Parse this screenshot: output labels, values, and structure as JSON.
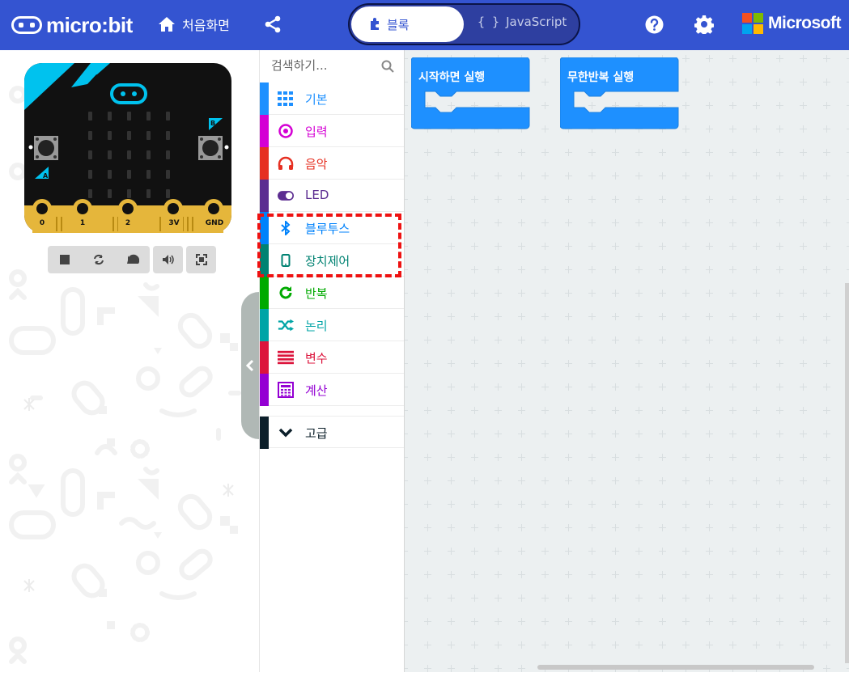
{
  "header": {
    "brand": "micro:bit",
    "home_label": "처음화면",
    "toggle": {
      "blocks_label": "블록",
      "js_label": "JavaScript",
      "js_braces": "{ }"
    },
    "ms_label": "Microsoft",
    "colors": {
      "bar": "#3454d1"
    }
  },
  "simulator": {
    "pins": [
      "0",
      "1",
      "2",
      "3V",
      "GND"
    ],
    "buttons": [
      "A",
      "B"
    ],
    "controls": [
      "stop-icon",
      "restart-icon",
      "slow-motion-icon",
      "mute-icon",
      "fullscreen-icon"
    ]
  },
  "toolbox": {
    "search_placeholder": "검색하기...",
    "categories": [
      {
        "label": "기본",
        "color": "#1e90ff",
        "icon": "grid-icon"
      },
      {
        "label": "입력",
        "color": "#d400d4",
        "icon": "target-icon"
      },
      {
        "label": "음악",
        "color": "#e63022",
        "icon": "headphones-icon"
      },
      {
        "label": "LED",
        "color": "#5c2d91",
        "icon": "toggle-icon"
      },
      {
        "label": "블루투스",
        "color": "#0082fb",
        "icon": "bluetooth-icon"
      },
      {
        "label": "장치제어",
        "color": "#008272",
        "icon": "phone-icon"
      },
      {
        "label": "반복",
        "color": "#00aa00",
        "icon": "refresh-icon"
      },
      {
        "label": "논리",
        "color": "#00a4a6",
        "icon": "shuffle-icon"
      },
      {
        "label": "변수",
        "color": "#dc143c",
        "icon": "lines-icon"
      },
      {
        "label": "계산",
        "color": "#9400d3",
        "icon": "calculator-icon"
      },
      {
        "label": "고급",
        "color": "#0c1f2a",
        "icon": "chevron-down-icon"
      }
    ]
  },
  "workspace": {
    "blocks": [
      {
        "label": "시작하면 실행",
        "color": "#1e90ff"
      },
      {
        "label": "무한반복 실행",
        "color": "#1e90ff"
      }
    ]
  }
}
